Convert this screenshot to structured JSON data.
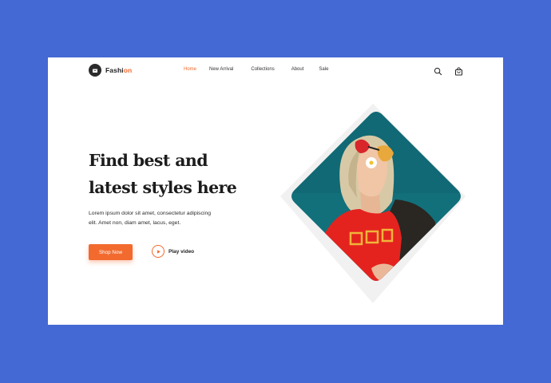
{
  "brand": {
    "name_part1": "Fashi",
    "name_part2": "on",
    "logo_icon": "shopping-bag-icon"
  },
  "nav": {
    "items": [
      {
        "label": "Home",
        "active": true
      },
      {
        "label": "New Arrival",
        "active": false
      },
      {
        "label": "Collections",
        "active": false
      },
      {
        "label": "About",
        "active": false
      },
      {
        "label": "Sale",
        "active": false
      }
    ]
  },
  "header_icons": {
    "search": "search-icon",
    "cart": "shopping-bag-icon"
  },
  "hero": {
    "title_line1": "Find best and",
    "title_line2": "latest styles here",
    "description_line1": "Lorem ipsum dolor sit amet, consectetur adipiscing",
    "description_line2": "elit. Amet non, diam amet, lacus, eget.",
    "shop_button_label": "Shop Now",
    "play_video_label": "Play video",
    "play_icon": "play-icon"
  },
  "colors": {
    "background": "#4469d4",
    "accent": "#f26a2e",
    "card": "#ffffff",
    "text": "#1c1c1c",
    "image_sky": "#12707a",
    "shirt": "#e4231f"
  }
}
